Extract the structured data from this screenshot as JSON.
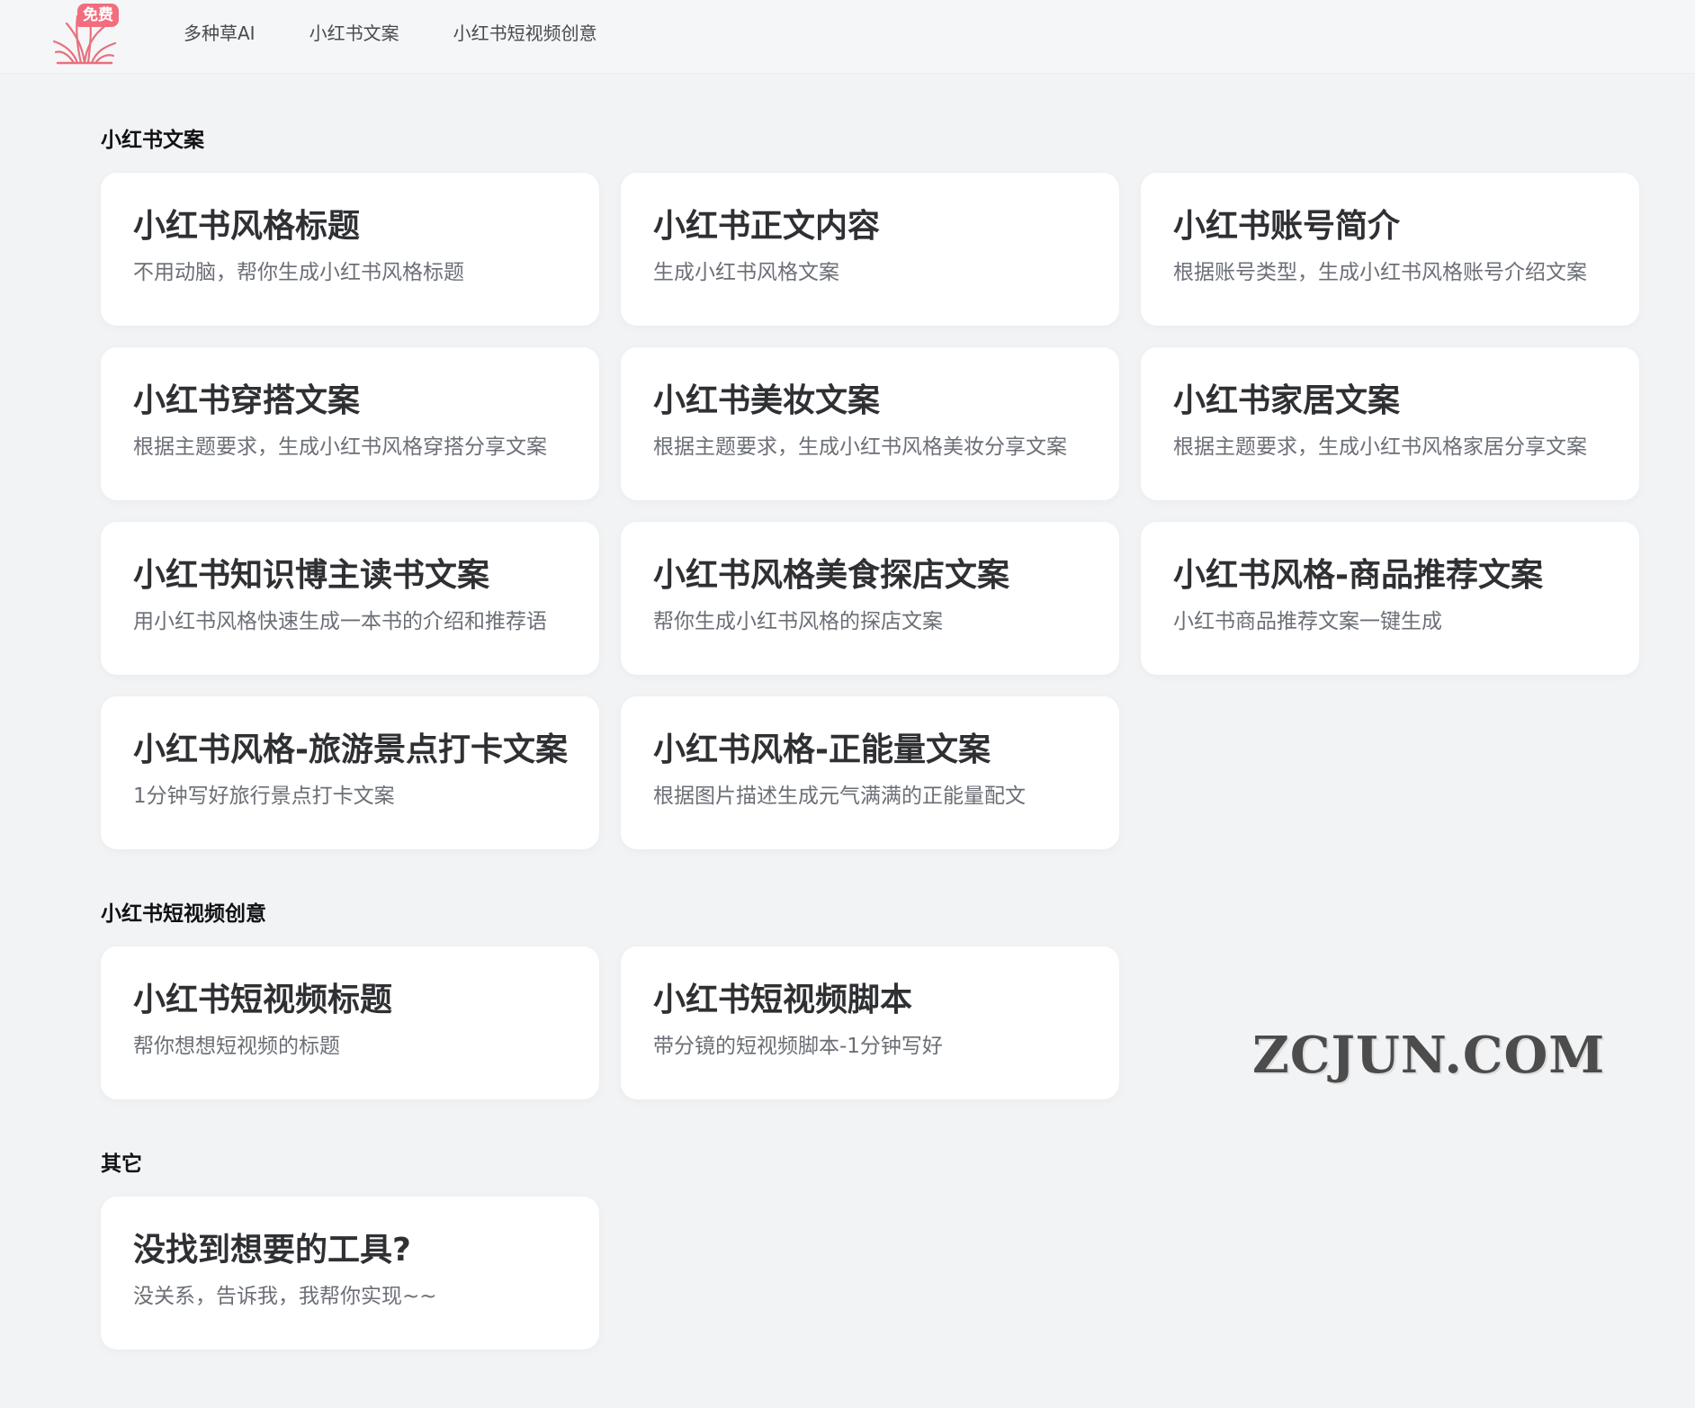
{
  "header": {
    "logo_badge": "免费",
    "nav": [
      "多种草AI",
      "小红书文案",
      "小红书短视频创意"
    ]
  },
  "sections": [
    {
      "title": "小红书文案",
      "cards": [
        {
          "title": "小红书风格标题",
          "desc": "不用动脑，帮你生成小红书风格标题"
        },
        {
          "title": "小红书正文内容",
          "desc": "生成小红书风格文案"
        },
        {
          "title": "小红书账号简介",
          "desc": "根据账号类型，生成小红书风格账号介绍文案"
        },
        {
          "title": "小红书穿搭文案",
          "desc": "根据主题要求，生成小红书风格穿搭分享文案"
        },
        {
          "title": "小红书美妆文案",
          "desc": "根据主题要求，生成小红书风格美妆分享文案"
        },
        {
          "title": "小红书家居文案",
          "desc": "根据主题要求，生成小红书风格家居分享文案"
        },
        {
          "title": "小红书知识博主读书文案",
          "desc": "用小红书风格快速生成一本书的介绍和推荐语"
        },
        {
          "title": "小红书风格美食探店文案",
          "desc": "帮你生成小红书风格的探店文案"
        },
        {
          "title": "小红书风格-商品推荐文案",
          "desc": "小红书商品推荐文案一键生成"
        },
        {
          "title": "小红书风格-旅游景点打卡文案",
          "desc": "1分钟写好旅行景点打卡文案"
        },
        {
          "title": "小红书风格-正能量文案",
          "desc": "根据图片描述生成元气满满的正能量配文"
        }
      ]
    },
    {
      "title": "小红书短视频创意",
      "cards": [
        {
          "title": "小红书短视频标题",
          "desc": "帮你想想短视频的标题"
        },
        {
          "title": "小红书短视频脚本",
          "desc": "带分镜的短视频脚本-1分钟写好"
        }
      ]
    },
    {
      "title": "其它",
      "cards": [
        {
          "title": "没找到想要的工具?",
          "desc": "没关系，告诉我，我帮你实现~~"
        }
      ]
    }
  ],
  "watermark": "ZCJUN.COM"
}
